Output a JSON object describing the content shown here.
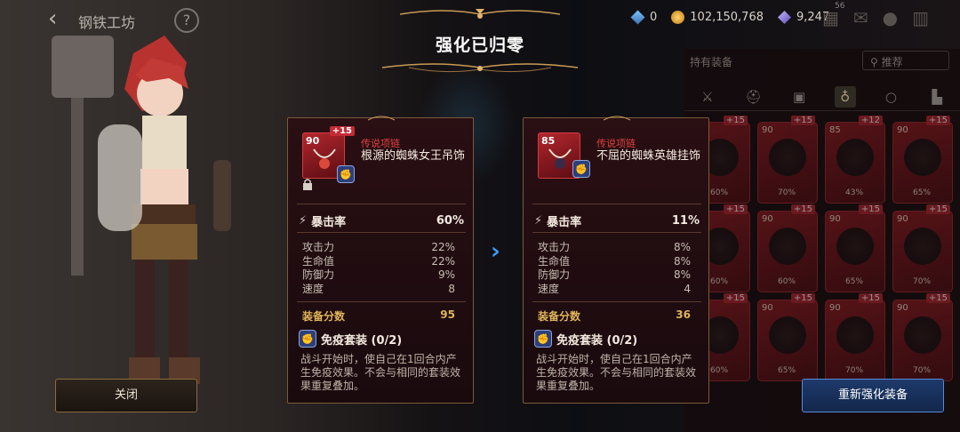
{
  "header": {
    "back_label": "钢铁工坊",
    "help_label": "?",
    "currency": {
      "gem": "0",
      "gold": "102,150,768",
      "crystal": "9,247"
    },
    "badge_count": "56"
  },
  "dialog": {
    "title": "强化已归零",
    "arrow": "›",
    "before": {
      "level": "90",
      "plus": "+15",
      "rarity": "传说项链",
      "name": "根源的蜘蛛女王吊饰",
      "main_stat_label": "暴击率",
      "main_stat_value": "60%",
      "substats": [
        {
          "label": "攻击力",
          "value": "22%"
        },
        {
          "label": "生命值",
          "value": "22%"
        },
        {
          "label": "防御力",
          "value": "9%"
        },
        {
          "label": "速度",
          "value": "8"
        }
      ],
      "score_label": "装备分数",
      "score_value": "95",
      "set_name": "免疫套装 (0/2)",
      "set_desc": "战斗开始时，使自己在1回合内产生免疫效果。不会与相同的套装效果重复叠加。"
    },
    "after": {
      "level": "85",
      "rarity": "传说项链",
      "name": "不屈的蜘蛛英雄挂饰",
      "main_stat_label": "暴击率",
      "main_stat_value": "11%",
      "substats": [
        {
          "label": "攻击力",
          "value": "8%"
        },
        {
          "label": "生命值",
          "value": "8%"
        },
        {
          "label": "防御力",
          "value": "8%"
        },
        {
          "label": "速度",
          "value": "4"
        }
      ],
      "score_label": "装备分数",
      "score_value": "36",
      "set_name": "免疫套装 (0/2)",
      "set_desc": "战斗开始时，使自己在1回合内产生免疫效果。不会与相同的套装效果重复叠加。"
    }
  },
  "inventory": {
    "label": "持有装备",
    "filter_label": "推荐",
    "tabs": [
      "sword-icon",
      "helmet-icon",
      "armor-icon",
      "necklace-icon",
      "ring-icon",
      "boots-icon"
    ],
    "cards": [
      {
        "level": "",
        "plus": "+15",
        "stat": "60%"
      },
      {
        "level": "90",
        "plus": "+15",
        "stat": "70%"
      },
      {
        "level": "85",
        "plus": "+12",
        "stat": "43%"
      },
      {
        "level": "90",
        "plus": "+15",
        "stat": "65%"
      },
      {
        "level": "",
        "plus": "+15",
        "stat": "60%"
      },
      {
        "level": "90",
        "plus": "+15",
        "stat": "60%"
      },
      {
        "level": "90",
        "plus": "+15",
        "stat": "65%"
      },
      {
        "level": "90",
        "plus": "+15",
        "stat": "70%"
      },
      {
        "level": "",
        "plus": "+15",
        "stat": "60%"
      },
      {
        "level": "90",
        "plus": "+15",
        "stat": "65%"
      },
      {
        "level": "90",
        "plus": "+15",
        "stat": "70%"
      },
      {
        "level": "90",
        "plus": "+15",
        "stat": "70%"
      }
    ]
  },
  "buttons": {
    "close": "关闭",
    "reforge": "重新强化装备"
  },
  "colors": {
    "accent_blue": "#3b9dff",
    "rarity_red": "#e0413f",
    "score_gold": "#e0b45a"
  }
}
